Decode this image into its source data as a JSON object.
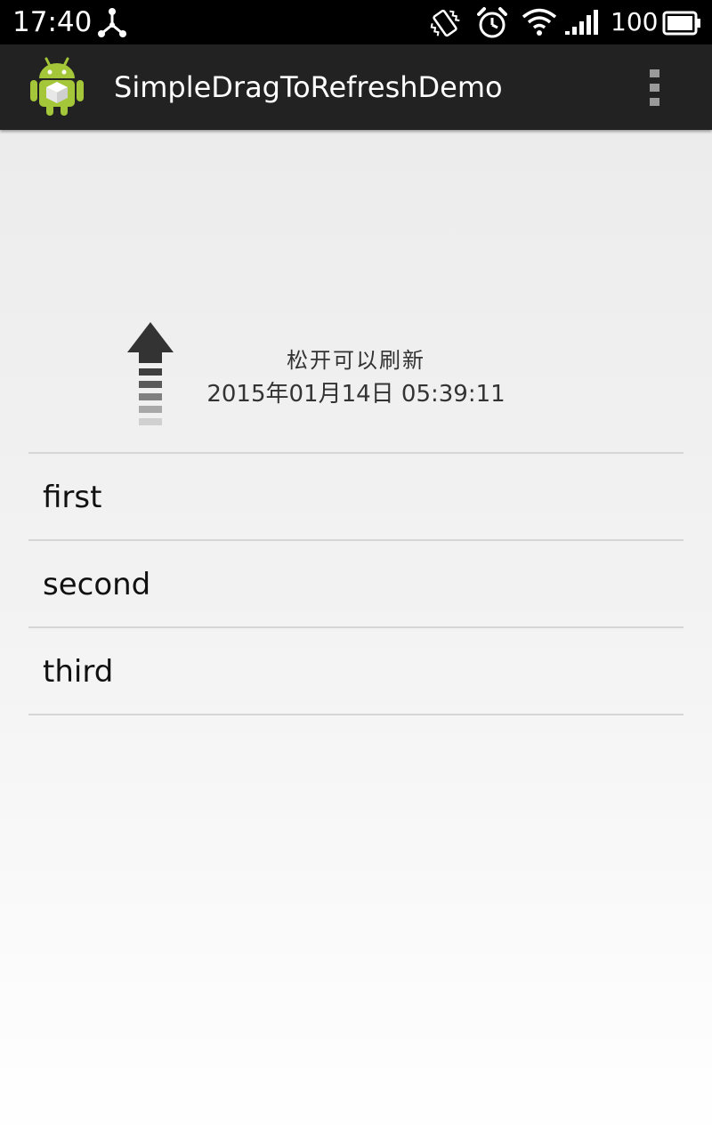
{
  "status_bar": {
    "time": "17:40",
    "battery_percent": "100",
    "icons": [
      "usb-debug-icon",
      "vibrate-icon",
      "alarm-icon",
      "wifi-icon",
      "signal-icon",
      "battery-icon"
    ]
  },
  "action_bar": {
    "title": "SimpleDragToRefreshDemo",
    "app_icon": "android-app-icon",
    "overflow_icon": "overflow-menu-icon"
  },
  "refresh_header": {
    "arrow_icon": "arrow-up-icon",
    "status": "松开可以刷新",
    "last_updated": "2015年01月14日 05:39:11"
  },
  "list": {
    "items": [
      {
        "label": "first"
      },
      {
        "label": "second"
      },
      {
        "label": "third"
      }
    ]
  },
  "colors": {
    "status_bar_bg": "#000000",
    "action_bar_bg": "#222222",
    "content_bg_top": "#ececec",
    "content_bg_bottom": "#ffffff",
    "divider": "#d6d6d6",
    "android_green": "#a4c639"
  }
}
